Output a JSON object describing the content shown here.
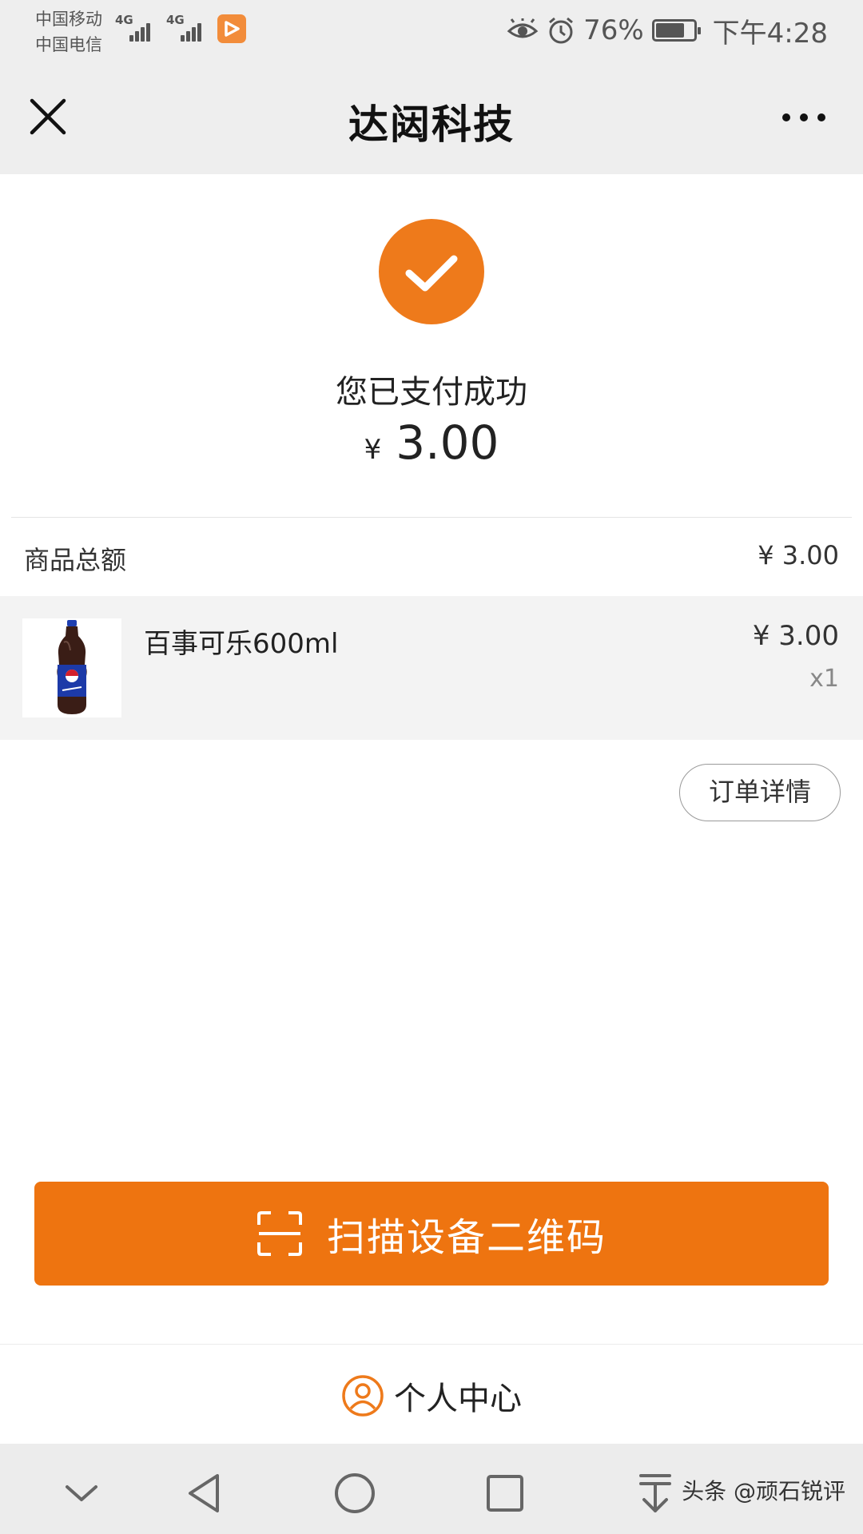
{
  "status_bar": {
    "carrier_1": "中国移动",
    "carrier_2": "中国电信",
    "network_1": "4G",
    "network_2": "4G",
    "battery_percent": "76%",
    "battery_level": 0.76,
    "time": "下午4:28",
    "icons": [
      "eye-icon",
      "alarm-icon",
      "battery-icon"
    ]
  },
  "header": {
    "title": "达闼科技",
    "close_icon": "close-icon",
    "more_icon": "more-icon"
  },
  "result": {
    "message": "您已支付成功",
    "currency": "¥",
    "amount": "3.00",
    "accent_color": "#ee7a1b"
  },
  "summary": {
    "total_label": "商品总额",
    "total_value": "¥ 3.00"
  },
  "items": [
    {
      "name": "百事可乐600ml",
      "price": "¥ 3.00",
      "quantity": "x1"
    }
  ],
  "actions": {
    "order_detail": "订单详情",
    "scan_button": "扫描设备二维码",
    "scan_button_color": "#ee7410",
    "personal_center": "个人中心"
  },
  "system_nav": {
    "icons": [
      "chevron-down-icon",
      "back-icon",
      "home-icon",
      "recents-icon",
      "pull-down-icon"
    ],
    "watermark": "头条 @顽石锐评"
  }
}
